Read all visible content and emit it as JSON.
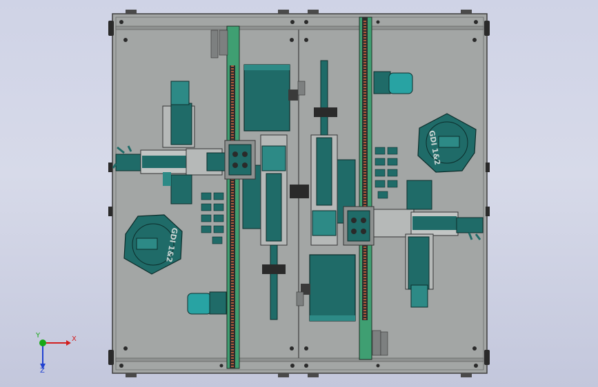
{
  "viewport": {
    "background_top": "#cfd3e6",
    "background_bottom": "#c3c7dc"
  },
  "colors": {
    "plate": "#a3a6a5",
    "plate_edge": "#3c3c3c",
    "rail_green": "#3f9f72",
    "rack_dark": "#2d2d2d",
    "teal_body": "#1f6b68",
    "teal_light": "#2d8a86",
    "gear_teeth": "#b05a3a",
    "cylinder_head": "#28a3a3"
  },
  "model": {
    "fixture_text": "GDI 1&2"
  },
  "triad": {
    "x_label": "X",
    "y_label": "Y",
    "z_label": "Z",
    "x_color": "#d21e1e",
    "y_color": "#16a816",
    "z_color": "#2040d0"
  }
}
